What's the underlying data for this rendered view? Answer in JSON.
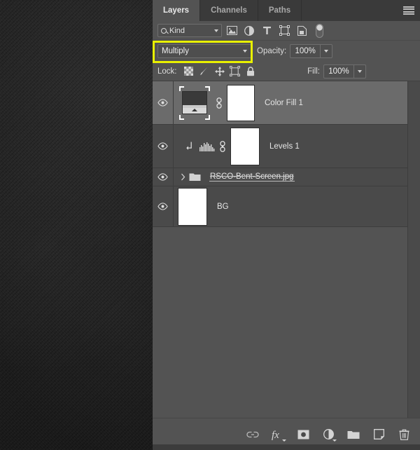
{
  "panel": {
    "tabs": [
      {
        "label": "Layers",
        "active": true
      },
      {
        "label": "Channels",
        "active": false
      },
      {
        "label": "Paths",
        "active": false
      }
    ],
    "menu_icon": "hamburger-menu-icon"
  },
  "filter": {
    "kind_label": "Kind",
    "kind_icon": "search-icon",
    "icons": [
      "pixel-layer-filter-icon",
      "adjustment-layer-filter-icon",
      "type-layer-filter-icon",
      "shape-layer-filter-icon",
      "smart-object-filter-icon"
    ],
    "toggle_icon": "filter-toggle-switch"
  },
  "blend": {
    "mode": "Multiply",
    "opacity_label": "Opacity:",
    "opacity_value": "100%",
    "highlight_color": "#e8f000",
    "highlighted": true
  },
  "lock": {
    "label": "Lock:",
    "icons": [
      "lock-transparent-pixels-icon",
      "lock-image-pixels-icon",
      "lock-position-icon",
      "lock-artboard-nesting-icon",
      "lock-all-icon"
    ],
    "fill_label": "Fill:",
    "fill_value": "100%"
  },
  "layers": [
    {
      "name": "Color Fill 1",
      "visible": true,
      "selected": true,
      "type": "adjustment",
      "has_mask": true,
      "linked": true,
      "clipped": false,
      "thumb": "screen-photo-thumbnail",
      "mask_thumb": "white-mask-thumbnail"
    },
    {
      "name": "Levels 1",
      "visible": true,
      "selected": false,
      "type": "adjustment",
      "has_mask": true,
      "linked": true,
      "clipped": true,
      "thumb": "levels-histogram-thumbnail",
      "mask_thumb": "white-mask-thumbnail"
    },
    {
      "name": "RSCO-Bent-Screen.jpg",
      "visible": true,
      "selected": false,
      "type": "group",
      "collapsed": true,
      "renaming": true,
      "thumb": "folder-icon"
    },
    {
      "name": "BG",
      "visible": true,
      "selected": false,
      "type": "pixel",
      "thumb": "white-thumbnail"
    }
  ],
  "bottom_bar": {
    "icons": [
      "link-layers-icon",
      "layer-style-fx-icon",
      "add-layer-mask-icon",
      "new-adjustment-layer-icon",
      "new-group-icon",
      "new-layer-icon",
      "delete-layer-icon"
    ]
  }
}
